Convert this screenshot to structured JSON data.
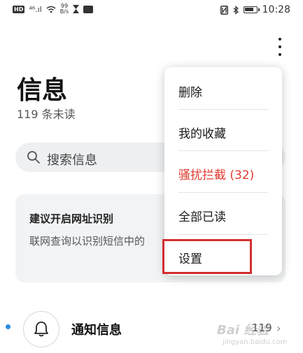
{
  "status_bar": {
    "hd_badge": "HD",
    "signal": "⁴⁶.ıl",
    "net_speed_value": "99",
    "net_speed_unit": "B/s",
    "time": "10:28"
  },
  "header": {
    "title": "信息",
    "unread": "119 条未读"
  },
  "search": {
    "placeholder": "搜索信息"
  },
  "suggestion": {
    "title": "建议开启网址识别",
    "description": "联网查询以识别短信中的"
  },
  "notifications": {
    "title": "通知信息",
    "count": "119"
  },
  "menu": {
    "items": [
      {
        "label": "删除"
      },
      {
        "label": "我的收藏"
      },
      {
        "label": "骚扰拦截 (32)"
      },
      {
        "label": "全部已读"
      },
      {
        "label": "设置"
      }
    ]
  },
  "watermark": {
    "main": "Bai 经验",
    "sub": "jingyan.baidu.com"
  },
  "colors": {
    "danger": "#e03b30",
    "highlight": "#d32f2f",
    "unread_dot": "#2a8be6"
  }
}
